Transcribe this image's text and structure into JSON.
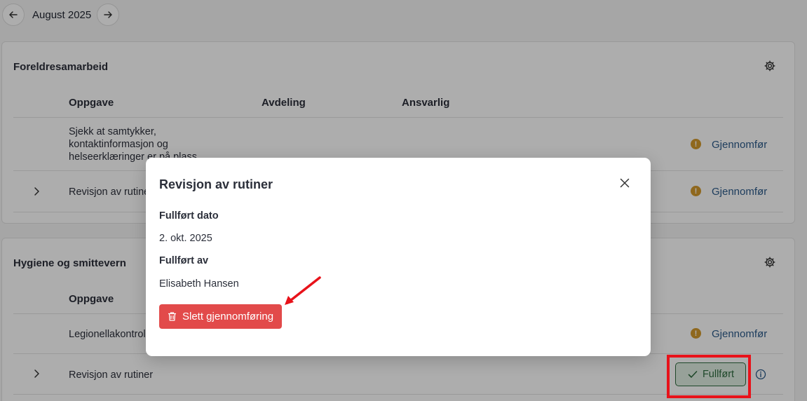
{
  "header": {
    "month": "August 2025"
  },
  "sections": [
    {
      "title": "Foreldresamarbeid",
      "columns": [
        "Oppgave",
        "Avdeling",
        "Ansvarlig"
      ],
      "rows": [
        {
          "task": "Sjekk at samtykker, kontaktinformasjon og helseerklæringer er på plass",
          "action": "Gjennomfør"
        },
        {
          "task": "Revisjon av rutiner",
          "action": "Gjennomfør"
        }
      ]
    },
    {
      "title": "Hygiene og smittevern",
      "columns": [
        "Oppgave"
      ],
      "rows": [
        {
          "task": "Legionellakontroll",
          "action": "Gjennomfør"
        },
        {
          "task": "Revisjon av rutiner",
          "action": "Fullført"
        }
      ]
    }
  ],
  "modal": {
    "title": "Revisjon av rutiner",
    "completed_date_label": "Fullført dato",
    "completed_date": "2. okt. 2025",
    "completed_by_label": "Fullført av",
    "completed_by": "Elisabeth Hansen",
    "delete_label": "Slett gjennomføring"
  },
  "colors": {
    "danger": "#e24a4a",
    "success": "#2e6b3f",
    "warning": "#d39a2d",
    "link": "#2c5a8a",
    "annotation": "#e8121a"
  },
  "icons": [
    "arrow-left-icon",
    "arrow-right-icon",
    "gear-icon",
    "chevron-right-icon",
    "warning-icon",
    "check-icon",
    "info-icon",
    "close-icon",
    "trash-icon"
  ]
}
